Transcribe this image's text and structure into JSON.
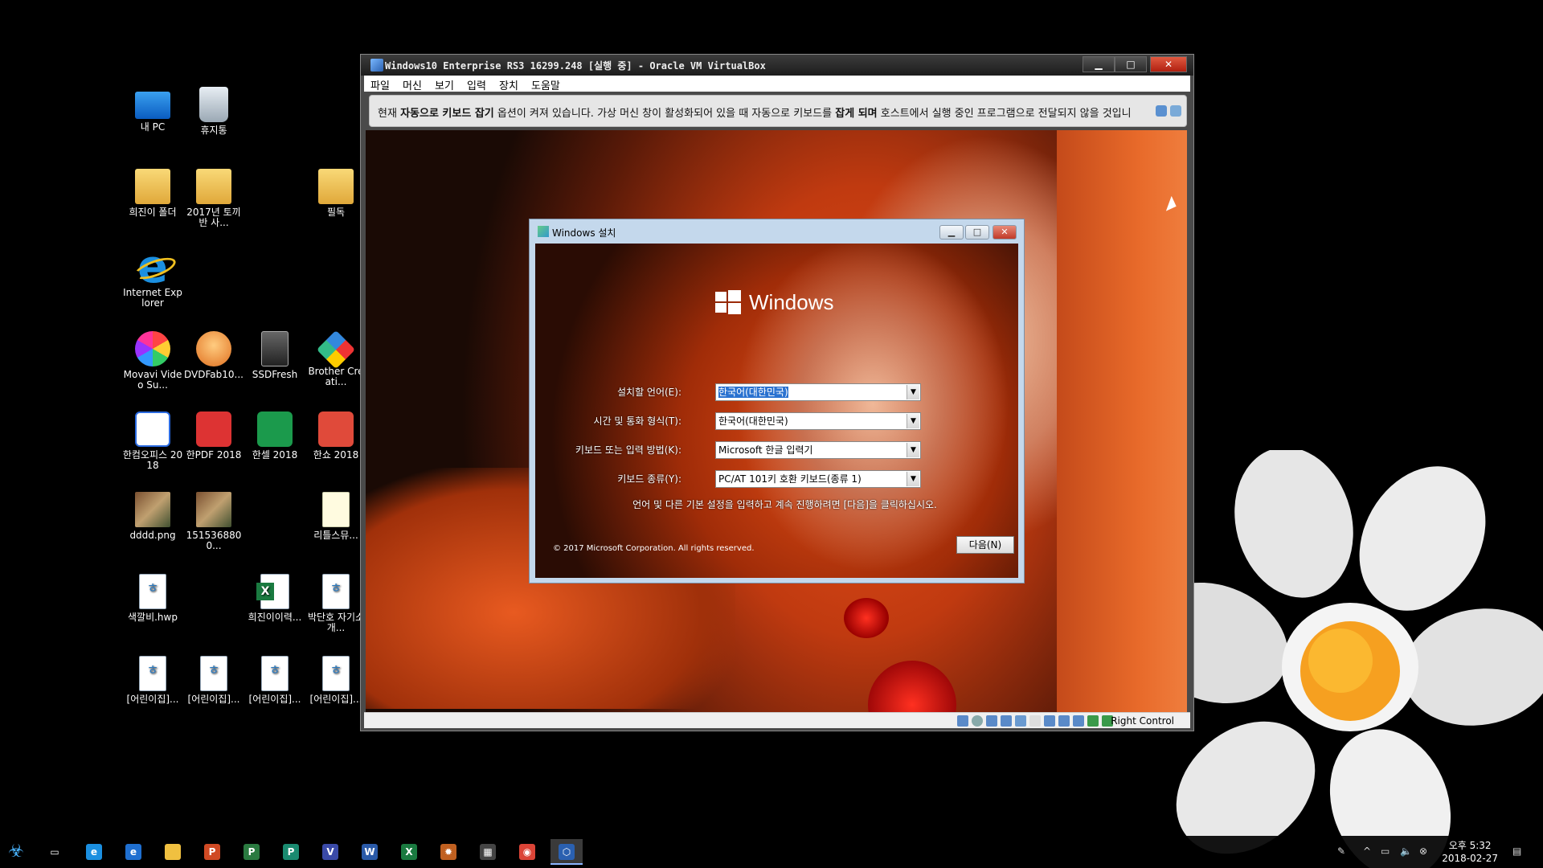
{
  "desktop": {
    "icons": [
      {
        "label": "내 PC"
      },
      {
        "label": "휴지통"
      },
      {
        "label": "희진이 폴더"
      },
      {
        "label": "2017년 토끼반 사..."
      },
      {
        "label": "필독"
      },
      {
        "label": "Internet Explorer"
      },
      {
        "label": "Movavi Video Su..."
      },
      {
        "label": "DVDFab10..."
      },
      {
        "label": "SSDFresh"
      },
      {
        "label": "Brother Creati..."
      },
      {
        "label": "한컴오피스 2018"
      },
      {
        "label": "한PDF 2018"
      },
      {
        "label": "한셀 2018"
      },
      {
        "label": "한쇼 2018"
      },
      {
        "label": "dddd.png"
      },
      {
        "label": "1515368800..."
      },
      {
        "label": "리틀스뮤..."
      },
      {
        "label": "색깔비.hwp"
      },
      {
        "label": "희진이이력..."
      },
      {
        "label": "박단호 자기소개..."
      },
      {
        "label": "[어린이집]..."
      },
      {
        "label": "[어린이집]..."
      },
      {
        "label": "[어린이집]..."
      },
      {
        "label": "[어린이집]..."
      }
    ]
  },
  "vbox": {
    "title": "Windows10 Enterprise RS3 16299.248 [실행 중] - Oracle VM VirtualBox",
    "menu": [
      "파일",
      "머신",
      "보기",
      "입력",
      "장치",
      "도움말"
    ],
    "notice": {
      "p1": "현재 ",
      "b1": "자동으로 키보드 잡기",
      "p2": " 옵션이 켜져 있습니다. 가상 머신 창이 활성화되어 있을 때 자동으로 키보드를 ",
      "b2": "잡게 되며",
      "p3": " 호스트에서 실행 중인 프로그램으로 전달되지 않을 것입니"
    },
    "host_key": "Right Control"
  },
  "setup": {
    "title": "Windows 설치",
    "brand": "Windows",
    "fields": [
      {
        "label": "설치할 언어(E):",
        "value": "한국어(대한민국)"
      },
      {
        "label": "시간 및 통화 형식(T):",
        "value": "한국어(대한민국)"
      },
      {
        "label": "키보드 또는 입력 방법(K):",
        "value": "Microsoft 한글 입력기"
      },
      {
        "label": "키보드 종류(Y):",
        "value": "PC/AT 101키 호환 키보드(종류 1)"
      }
    ],
    "hint": "언어 및 다른 기본 설정을 입력하고 계속 진행하려면 [다음]을 클릭하십시오.",
    "copyright": "© 2017 Microsoft Corporation. All rights reserved.",
    "next_label": "다음(N)"
  },
  "taskbar": {
    "apps": [
      {
        "icon": "task-view-icon",
        "glyph": "▭",
        "color": "#000000"
      },
      {
        "icon": "ie-icon",
        "glyph": "e",
        "color": "#1b8fe0"
      },
      {
        "icon": "edge-icon",
        "glyph": "e",
        "color": "#1f6fd0"
      },
      {
        "icon": "file-explorer-icon",
        "glyph": "",
        "color": "#f0c040"
      },
      {
        "icon": "powerpoint-icon",
        "glyph": "P",
        "color": "#d04a24"
      },
      {
        "icon": "project-icon",
        "glyph": "P",
        "color": "#2a7a40"
      },
      {
        "icon": "publisher-icon",
        "glyph": "P",
        "color": "#1a8a70"
      },
      {
        "icon": "visio-icon",
        "glyph": "V",
        "color": "#3a4aa8"
      },
      {
        "icon": "word-icon",
        "glyph": "W",
        "color": "#2a5aa8"
      },
      {
        "icon": "excel-icon",
        "glyph": "X",
        "color": "#1a7a40"
      },
      {
        "icon": "settings-app-icon",
        "glyph": "✹",
        "color": "#c06020"
      },
      {
        "icon": "calculator-icon",
        "glyph": "▦",
        "color": "#444444"
      },
      {
        "icon": "chrome-icon",
        "glyph": "◉",
        "color": "#db4437"
      },
      {
        "icon": "virtualbox-icon",
        "glyph": "⬡",
        "color": "#2a60b0"
      }
    ],
    "clock_time": "오후 5:32",
    "clock_date": "2018-02-27"
  }
}
